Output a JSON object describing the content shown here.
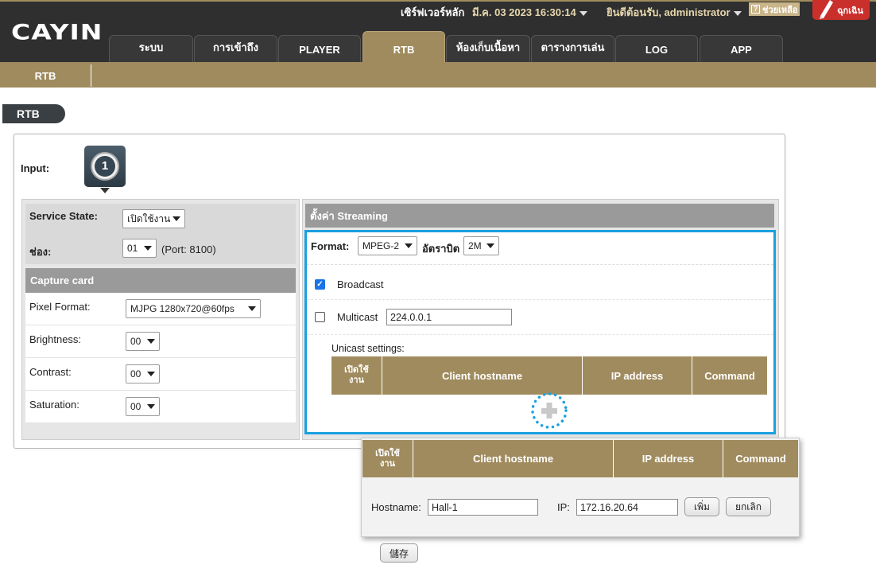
{
  "header": {
    "server_label": "เซิร์ฟเวอร์หลัก",
    "datetime": "มี.ค. 03 2023 16:30:14",
    "welcome": "ยินดีต้อนรับ, administrator",
    "help": "ช่วยเหลือ",
    "emergency": "ฉุกเฉิน",
    "logo": "CAYIN"
  },
  "tabs": [
    "ระบบ",
    "การเข้าถึง",
    "PLAYER",
    "RTB",
    "ห้องเก็บเนื้อหา",
    "ตารางการเล่น",
    "LOG",
    "APP"
  ],
  "subtab": "RTB",
  "page_title": "RTB",
  "input": {
    "label": "Input:",
    "number": "1"
  },
  "service": {
    "state_label": "Service State:",
    "state_value": "เปิดใช้งาน",
    "channel_label": "ช่อง:",
    "channel_value": "01",
    "port_text": "(Port: 8100)"
  },
  "capture": {
    "title": "Capture card",
    "pixel_format_label": "Pixel Format:",
    "pixel_format_value": "MJPG 1280x720@60fps",
    "brightness_label": "Brightness:",
    "brightness_value": "00",
    "contrast_label": "Contrast:",
    "contrast_value": "00",
    "saturation_label": "Saturation:",
    "saturation_value": "00"
  },
  "streaming": {
    "title": "ตั้งค่า Streaming",
    "format_label": "Format:",
    "format_value": "MPEG-2",
    "bitrate_label": "อัตราบิต",
    "bitrate_value": "2M",
    "broadcast_label": "Broadcast",
    "broadcast_checked": true,
    "multicast_label": "Multicast",
    "multicast_checked": false,
    "multicast_ip": "224.0.0.1",
    "unicast_label": "Unicast settings:",
    "columns": [
      "เปิดใช้งาน",
      "Client hostname",
      "IP address",
      "Command"
    ]
  },
  "popup": {
    "columns": [
      "เปิดใช้งาน",
      "Client hostname",
      "IP address",
      "Command"
    ],
    "hostname_label": "Hostname:",
    "hostname_value": "Hall-1",
    "ip_label": "IP:",
    "ip_value": "172.16.20.64",
    "add_button": "เพิ่ม",
    "cancel_button": "ยกเลิก"
  },
  "save_button": "儲存",
  "colors": {
    "gold": "#a08b5e",
    "dark": "#2f2f2f",
    "accent_blue": "#1aa0e0",
    "emergency_red": "#c9302c"
  }
}
